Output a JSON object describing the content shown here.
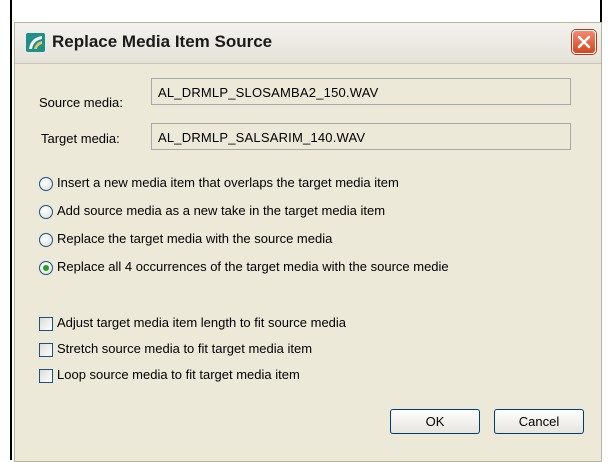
{
  "window": {
    "title": "Replace Media Item Source"
  },
  "fields": {
    "source_label": "Source media:",
    "source_value": "AL_DRMLP_SLOSAMBA2_150.WAV",
    "target_label": "Target media:",
    "target_value": "AL_DRMLP_SALSARIM_140.WAV"
  },
  "options": [
    {
      "label": "Insert a new media item that overlaps the target media item",
      "selected": false
    },
    {
      "label": "Add source media as a new take in the target media item",
      "selected": false
    },
    {
      "label": "Replace the target media with the source media",
      "selected": false
    },
    {
      "label": "Replace all 4 occurrences of the target media with the source medie",
      "selected": true
    }
  ],
  "checkboxes": [
    {
      "label": "Adjust target media item length to fit source media",
      "checked": false
    },
    {
      "label": "Stretch source media to fit target media item",
      "checked": false
    },
    {
      "label": "Loop source media to fit target media item",
      "checked": false
    }
  ],
  "buttons": {
    "ok_label": "OK",
    "cancel_label": "Cancel"
  },
  "colors": {
    "dialog_bg": "#ece9d8",
    "close_button": "#d6461f",
    "radio_selected": "#24a024",
    "control_border": "#1c5180"
  }
}
